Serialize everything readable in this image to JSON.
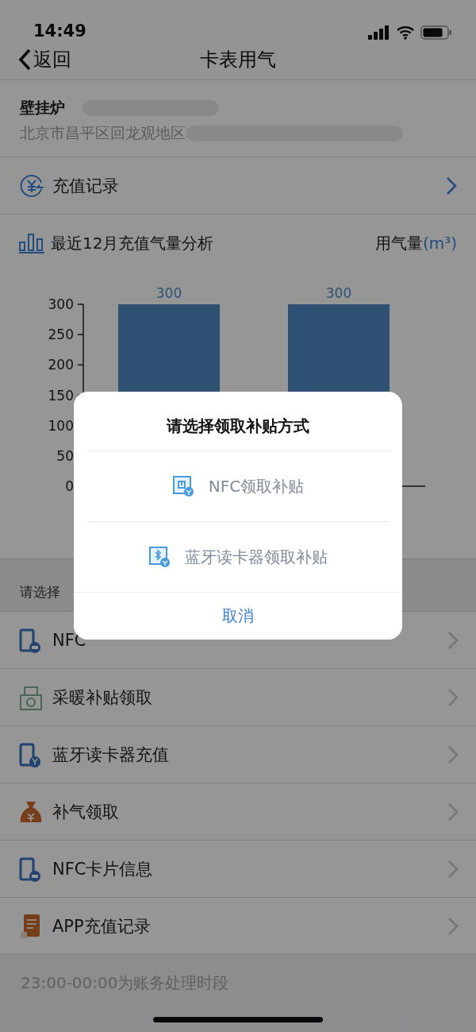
{
  "status_bar": {
    "time": "14:49"
  },
  "nav": {
    "back": "返回",
    "title": "卡表用气"
  },
  "device": {
    "name": "壁挂炉",
    "address": "北京市昌平区回龙观地区"
  },
  "record_link": {
    "label": "充值记录"
  },
  "chart": {
    "title": "最近12月充值气量分析",
    "unit_label": "用气量",
    "unit": "(m³)",
    "chart_data": {
      "type": "bar",
      "values": [
        300,
        300
      ],
      "ylim": [
        0,
        300
      ],
      "yticks": [
        0,
        50,
        100,
        150,
        200,
        250,
        300
      ],
      "data_labels": true
    }
  },
  "section_header": "请选择",
  "menu": [
    {
      "label": "NFC",
      "kind": "phone"
    },
    {
      "label": "采暖补贴领取",
      "kind": "cashbox"
    },
    {
      "label": "蓝牙读卡器充值",
      "kind": "phone-yen"
    },
    {
      "label": "补气领取",
      "kind": "bag"
    },
    {
      "label": "NFC卡片信息",
      "kind": "phone"
    },
    {
      "label": "APP充值记录",
      "kind": "book"
    }
  ],
  "footer_note": "23:00-00:00为账务处理时段",
  "dialog": {
    "title": "请选择领取补贴方式",
    "options": [
      {
        "label": "NFC领取补贴",
        "kind": "nfc"
      },
      {
        "label": "蓝牙读卡器领取补贴",
        "kind": "bluetooth"
      }
    ],
    "cancel": "取消"
  }
}
